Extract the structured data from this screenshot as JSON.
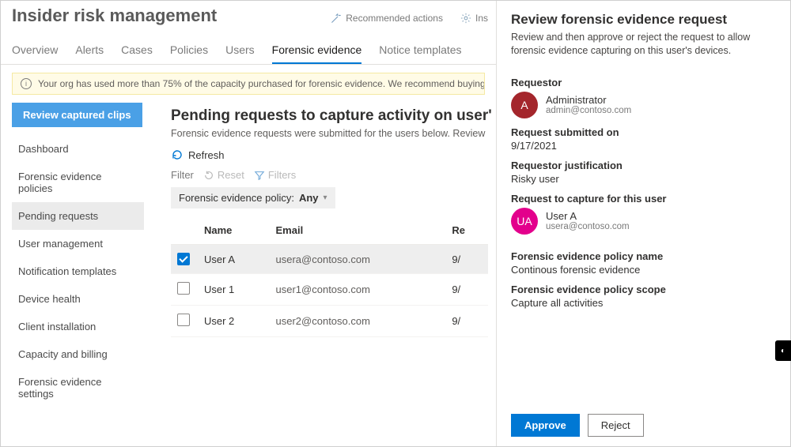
{
  "page_title": "Insider risk management",
  "commands": {
    "recommended": "Recommended actions",
    "insider": "Ins"
  },
  "tabs": [
    "Overview",
    "Alerts",
    "Cases",
    "Policies",
    "Users",
    "Forensic evidence",
    "Notice templates"
  ],
  "active_tab_index": 5,
  "warning": "Your org has used more than 75% of the capacity purchased for forensic evidence. We recommend buying more capacity units before the limit is",
  "left_nav": {
    "button": "Review captured clips",
    "items": [
      "Dashboard",
      "Forensic evidence policies",
      "Pending requests",
      "User management",
      "Notification templates",
      "Device health",
      "Client installation",
      "Capacity and billing",
      "Forensic evidence settings"
    ],
    "active_index": 2
  },
  "center": {
    "heading": "Pending requests to capture activity on user'",
    "subtext": "Forensic evidence requests were submitted for the users below. Review each requ",
    "refresh_label": "Refresh",
    "filter_label": "Filter",
    "reset_label": "Reset",
    "filters_label": "Filters",
    "policy_pill_label": "Forensic evidence policy:",
    "policy_pill_value": "Any",
    "columns": [
      "Name",
      "Email",
      "Re"
    ],
    "rows": [
      {
        "checked": true,
        "name": "User A",
        "email": "usera@contoso.com",
        "date": "9/"
      },
      {
        "checked": false,
        "name": "User 1",
        "email": "user1@contoso.com",
        "date": "9/"
      },
      {
        "checked": false,
        "name": "User 2",
        "email": "user2@contoso.com",
        "date": "9/"
      }
    ]
  },
  "panel": {
    "title": "Review forensic evidence request",
    "desc": "Review and then approve or reject the request to allow forensic evidence capturing on this user's devices.",
    "requestor_label": "Requestor",
    "requestor": {
      "initials": "A",
      "name": "Administrator",
      "email": "admin@contoso.com"
    },
    "submitted_label": "Request submitted on",
    "submitted_value": "9/17/2021",
    "justification_label": "Requestor justification",
    "justification_value": "Risky user",
    "capture_label": "Request to capture for this user",
    "capture_user": {
      "initials": "UA",
      "name": "User A",
      "email": "usera@contoso.com"
    },
    "policy_name_label": "Forensic evidence policy name",
    "policy_name_value": "Continous forensic evidence",
    "policy_scope_label": "Forensic evidence policy scope",
    "policy_scope_value": "Capture all activities",
    "approve": "Approve",
    "reject": "Reject"
  }
}
